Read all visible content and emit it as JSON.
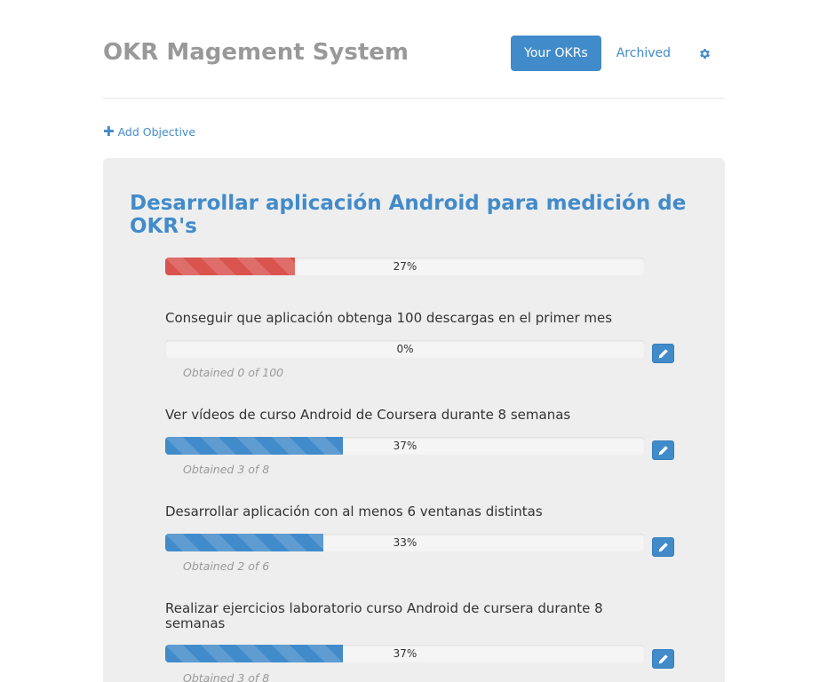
{
  "header": {
    "title": "OKR Magement System",
    "nav": {
      "your_okrs": "Your OKRs",
      "archived": "Archived",
      "settings_icon": "gear-icon"
    }
  },
  "actions": {
    "add_objective_label": "Add Objective",
    "add_icon": "plus-icon"
  },
  "colors": {
    "accent": "#428bca",
    "danger": "#d9534f",
    "title_gray": "#999999",
    "card_bg": "#eeeeee"
  },
  "objective": {
    "title": "Desarrollar aplicación Android para medición de OKR's",
    "progress": 27,
    "progress_label": "27%",
    "progress_style": "danger",
    "key_results": [
      {
        "title": "Conseguir que aplicación obtenga 100 descargas en el primer mes",
        "progress": 0,
        "progress_label": "0%",
        "obtained": "Obtained 0 of 100"
      },
      {
        "title": "Ver vídeos de curso Android de Coursera durante 8 semanas",
        "progress": 37,
        "progress_label": "37%",
        "obtained": "Obtained 3 of 8"
      },
      {
        "title": "Desarrollar aplicación con al menos 6 ventanas distintas",
        "progress": 33,
        "progress_label": "33%",
        "obtained": "Obtained 2 of 6"
      },
      {
        "title": "Realizar ejercicios laboratorio curso Android de cursera durante 8 semanas",
        "progress": 37,
        "progress_label": "37%",
        "obtained": "Obtained 3 of 8"
      }
    ]
  }
}
